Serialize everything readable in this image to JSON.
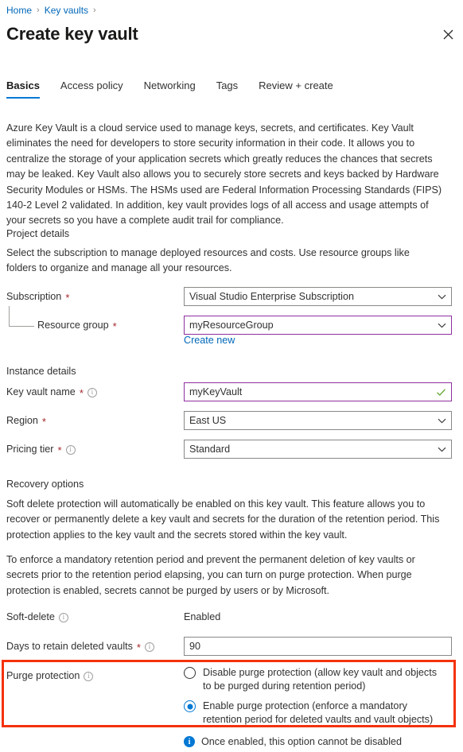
{
  "breadcrumb": {
    "items": [
      {
        "label": "Home"
      },
      {
        "label": "Key vaults"
      }
    ],
    "separator": "›"
  },
  "header": {
    "title": "Create key vault",
    "close_icon": "close-icon"
  },
  "tabs": [
    {
      "label": "Basics",
      "active": true
    },
    {
      "label": "Access policy",
      "active": false
    },
    {
      "label": "Networking",
      "active": false
    },
    {
      "label": "Tags",
      "active": false
    },
    {
      "label": "Review + create",
      "active": false
    }
  ],
  "intro": "Azure Key Vault is a cloud service used to manage keys, secrets, and certificates. Key Vault eliminates the need for developers to store security information in their code. It allows you to centralize the storage of your application secrets which greatly reduces the chances that secrets may be leaked. Key Vault also allows you to securely store secrets and keys backed by Hardware Security Modules or HSMs. The HSMs used are Federal Information Processing Standards (FIPS) 140-2 Level 2 validated. In addition, key vault provides logs of all access and usage attempts of your secrets so you have a complete audit trail for compliance.",
  "project_details": {
    "heading": "Project details",
    "description": "Select the subscription to manage deployed resources and costs. Use resource groups like folders to organize and manage all your resources.",
    "subscription": {
      "label": "Subscription",
      "required": "*",
      "value": "Visual Studio Enterprise Subscription"
    },
    "resource_group": {
      "label": "Resource group",
      "required": "*",
      "value": "myResourceGroup",
      "create_new_link": "Create new"
    }
  },
  "instance_details": {
    "heading": "Instance details",
    "key_vault_name": {
      "label": "Key vault name",
      "required": "*",
      "value": "myKeyVault",
      "validation_icon": "checkmark-icon"
    },
    "region": {
      "label": "Region",
      "required": "*",
      "value": "East US"
    },
    "pricing_tier": {
      "label": "Pricing tier",
      "required": "*",
      "value": "Standard"
    }
  },
  "recovery_options": {
    "heading": "Recovery options",
    "paragraph1": "Soft delete protection will automatically be enabled on this key vault. This feature allows you to recover or permanently delete a key vault and secrets for the duration of the retention period. This protection applies to the key vault and the secrets stored within the key vault.",
    "paragraph2": "To enforce a mandatory retention period and prevent the permanent deletion of key vaults or secrets prior to the retention period elapsing, you can turn on purge protection. When purge protection is enabled, secrets cannot be purged by users or by Microsoft.",
    "soft_delete": {
      "label": "Soft-delete",
      "value": "Enabled"
    },
    "days_to_retain": {
      "label": "Days to retain deleted vaults",
      "required": "*",
      "value": "90"
    },
    "purge_protection": {
      "label": "Purge protection",
      "options": [
        {
          "label": "Disable purge protection (allow key vault and objects to be purged during retention period)",
          "selected": false
        },
        {
          "label": "Enable purge protection (enforce a mandatory retention period for deleted vaults and vault objects)",
          "selected": true
        }
      ],
      "note": "Once enabled, this option cannot be disabled"
    }
  },
  "colors": {
    "link": "#0067b8",
    "accent": "#0078d4",
    "required_asterisk": "#a4262c",
    "focus_border": "#8f2fa0",
    "valid_check": "#5ea72f",
    "highlight_box": "#f4320c"
  }
}
